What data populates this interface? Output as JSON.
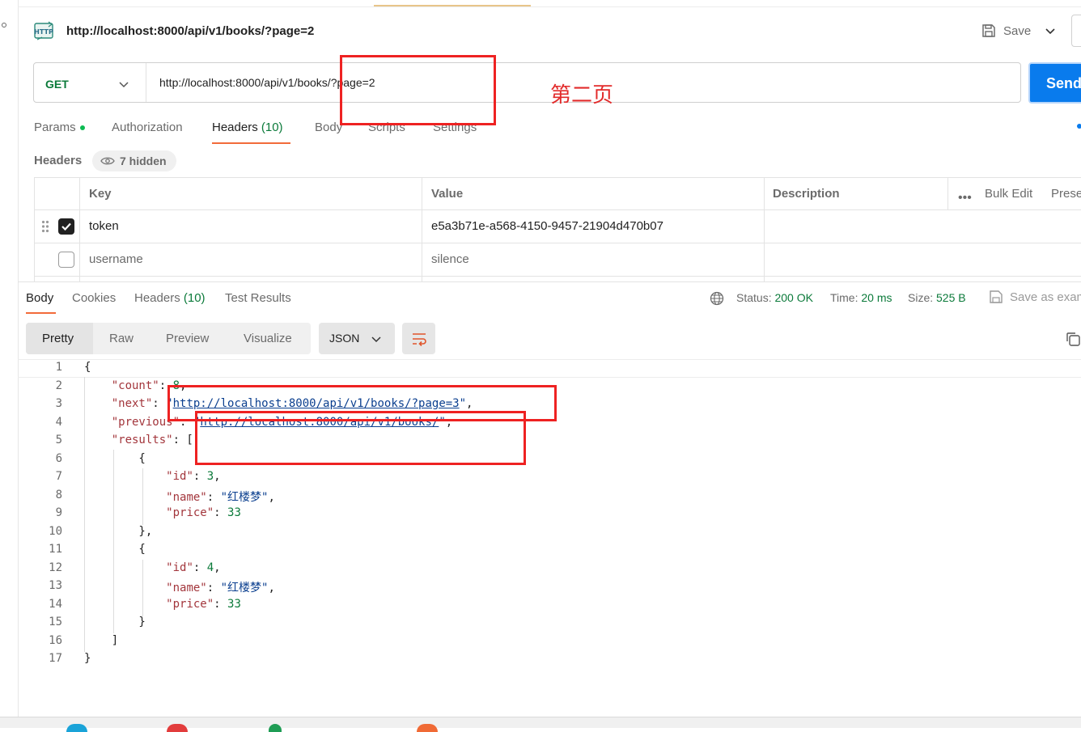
{
  "header": {
    "icon": "http-request-icon",
    "request_title": "http://localhost:8000/api/v1/books/?page=2",
    "save_label": "Save"
  },
  "url_bar": {
    "method": "GET",
    "url": "http://localhost:8000/api/v1/books/?page=2",
    "send_label": "Send"
  },
  "annotation": {
    "note": "第二页",
    "color": "#ee2222"
  },
  "request_tabs": [
    {
      "label": "Params"
    },
    {
      "label": "Authorization"
    },
    {
      "label": "Headers",
      "count": "(10)"
    },
    {
      "label": "Body"
    },
    {
      "label": "Scripts"
    },
    {
      "label": "Settings"
    }
  ],
  "headers_section": {
    "title": "Headers",
    "hidden_label": "7 hidden",
    "columns": [
      "Key",
      "Value",
      "Description"
    ],
    "bulk_edit": "Bulk Edit",
    "presets": "Presets",
    "rows": [
      {
        "key": "token",
        "value": "e5a3b71e-a568-4150-9457-21904d470b07",
        "checked": true
      },
      {
        "key": "username",
        "value": "silence",
        "checked": false
      }
    ]
  },
  "response_tabs": [
    {
      "label": "Body"
    },
    {
      "label": "Cookies"
    },
    {
      "label": "Headers",
      "count": "(10)"
    },
    {
      "label": "Test Results"
    }
  ],
  "response_meta": {
    "status_label": "Status:",
    "status_value": "200 OK",
    "time_label": "Time:",
    "time_value": "20 ms",
    "size_label": "Size:",
    "size_value": "525 B",
    "save_example": "Save as example"
  },
  "view_modes": [
    "Pretty",
    "Raw",
    "Preview",
    "Visualize"
  ],
  "format": "JSON",
  "code": {
    "count_key": "\"count\"",
    "count_val": "8",
    "next_key": "\"next\"",
    "next_val": "http://localhost:8000/api/v1/books/?page=3",
    "previous_key": "\"previous\"",
    "previous_val": "http://localhost:8000/api/v1/books/",
    "results_key": "\"results\"",
    "items": [
      {
        "id": "3",
        "name": "\"红楼梦\"",
        "price": "33"
      },
      {
        "id": "4",
        "name": "\"红楼梦\"",
        "price": "33"
      }
    ],
    "id_key": "\"id\"",
    "name_key": "\"name\"",
    "price_key": "\"price\"",
    "line_numbers": [
      "1",
      "2",
      "3",
      "4",
      "5",
      "6",
      "7",
      "8",
      "9",
      "10",
      "11",
      "12",
      "13",
      "14",
      "15",
      "16",
      "17"
    ]
  },
  "colors": {
    "accent_orange": "#f26b3a",
    "send_blue": "#097bed",
    "method_green": "#0b7a3a",
    "json_key": "#a3363c",
    "json_string": "#0b3f8f"
  }
}
